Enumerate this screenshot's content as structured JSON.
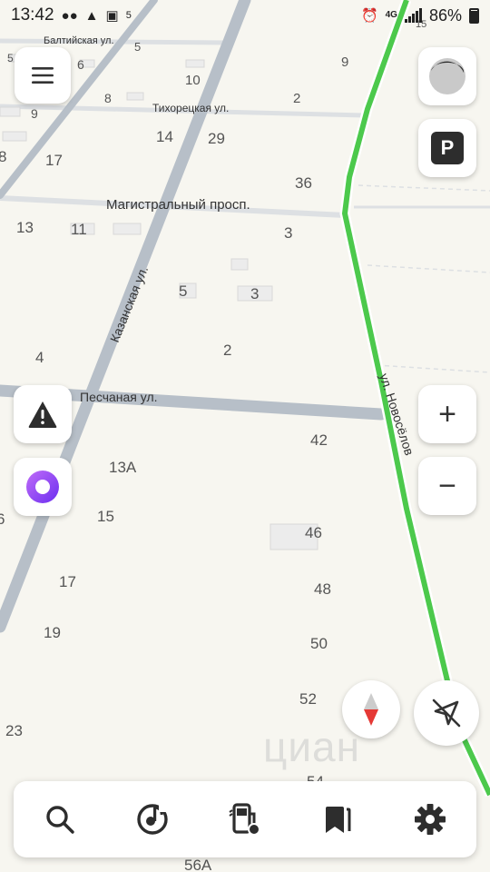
{
  "status_bar": {
    "time": "13:42",
    "network": "4G",
    "battery": "86%",
    "small_label": "5",
    "icons": [
      "bubble-icon",
      "warning-icon",
      "wifi-icon",
      "alarm-icon",
      "signal-icon",
      "battery-icon"
    ]
  },
  "map": {
    "streets": {
      "baltiyskaya": "Балтийская ул.",
      "tikhoretskaya": "Тихорецкая ул.",
      "magistralny": "Магистральный просп.",
      "kazanskaya": "Казанская ул.",
      "peschanaya": "Песчаная ул.",
      "novoselov": "ул. Новосёлов"
    },
    "house_numbers": [
      "5",
      "3",
      "6",
      "5",
      "9",
      "10",
      "2",
      "8",
      "9",
      "14",
      "29",
      "8",
      "17",
      "36",
      "13",
      "11",
      "3",
      "5",
      "3",
      "2",
      "4",
      "42",
      "13А",
      "6",
      "15",
      "46",
      "17",
      "48",
      "19",
      "50",
      "52",
      "23",
      "15",
      "56А",
      "54"
    ],
    "route_color": "#4cc94c",
    "road_color": "#b7bfc8",
    "watermark": "циан"
  },
  "controls": {
    "menu_icon": "menu-icon",
    "layers_icon": "layers-icon",
    "parking_label": "P",
    "alert_icon": "road-alert-icon",
    "assistant_icon": "alice-icon",
    "zoom_in_label": "+",
    "zoom_out_label": "−",
    "compass_icon": "compass-icon",
    "location_icon": "location-off-icon"
  },
  "bottom_nav": {
    "items": [
      "search-icon",
      "music-icon",
      "fuel-icon",
      "bookmarks-icon",
      "settings-icon"
    ]
  },
  "colors": {
    "accent_purple": "#8a3ff0",
    "compass_red": "#e53935",
    "control_dark": "#2d2d2d"
  }
}
